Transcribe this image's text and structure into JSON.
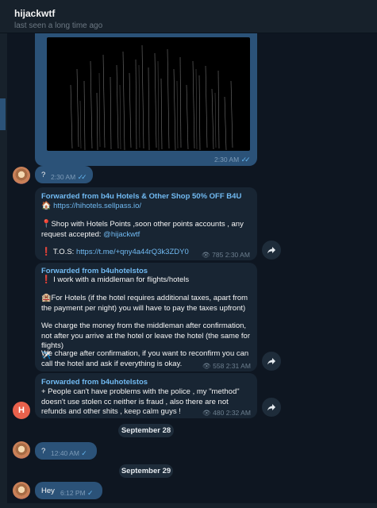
{
  "header": {
    "contact_name": "hijackwtf",
    "status": "last seen a long time ago"
  },
  "messages": {
    "video": {
      "time": "2:30 AM",
      "check": "✓✓"
    },
    "q1": {
      "text": "?",
      "time": "2:30 AM",
      "check": "✓✓"
    },
    "fwd1": {
      "from": "Forwarded from b4u Hotels & Other Shop 50% OFF B4U",
      "house_emoji": "🏠",
      "link": "https://hihotels.sellpass.io/",
      "pin_emoji": "📍",
      "line2": "Shop with Hotels Points ,soon other points accounts , any request accepted: ",
      "mention": "@hijackwtf",
      "excl_emoji": "❗",
      "tos_label": "T.O.S: ",
      "tos_link": "https://t.me/+qny4a44rQ3k3ZDY0",
      "views": "785",
      "time": "2:30 AM"
    },
    "fwd2": {
      "from": "Forwarded from b4uhotelstos",
      "excl_emoji": "❗",
      "line1": "I work with a middleman for flights/hotels",
      "hotel_emoji": "🏨",
      "line2": "For Hotels (if the hotel requires additional taxes, apart from the payment per night) you will have to pay the taxes upfront)",
      "line3": "We charge the money from the middleman after confirmation, not after you arrive at the hotel or leave the hotel (the same for flights)",
      "plane_emoji": "✈️",
      "line4": "We charge after confirmation, if you want to reconfirm you can call the hotel and ask if everything is okay.",
      "views": "558",
      "time": "2:31 AM"
    },
    "fwd3": {
      "from": "Forwarded from b4uhotelstos",
      "text": "+ People can't have problems with the police , my \"method\" doesn't use stolen cc neither is fraud , also there are not refunds and other shits , keep calm guys !",
      "views": "480",
      "time": "2:32 AM",
      "avatar_letter": "H"
    },
    "date1": "September 28",
    "q2": {
      "text": "?",
      "time": "12:40 AM",
      "check": "✓"
    },
    "date2": "September 29",
    "hey": {
      "text": "Hey",
      "time": "6:12 PM",
      "check": "✓"
    }
  },
  "icons": {
    "share": "share-arrow-icon",
    "views": "eye-icon"
  },
  "colors": {
    "background": "#0e1621",
    "incoming_bubble": "#182533",
    "outgoing_bubble": "#2b5278",
    "link": "#71baf2"
  }
}
